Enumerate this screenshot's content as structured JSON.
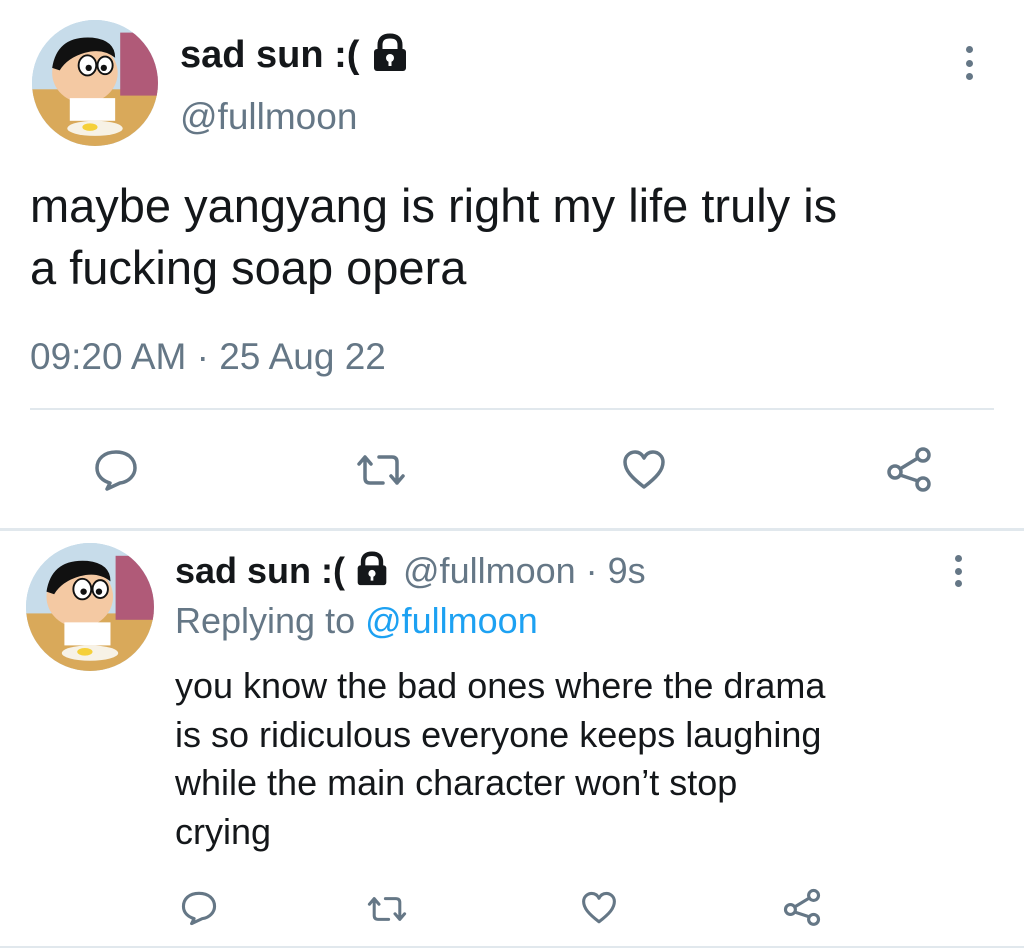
{
  "main_tweet": {
    "display_name": "sad sun :(",
    "handle": "@fullmoon",
    "text_line1": "maybe yangyang is right my life truly is",
    "text_line2": "a fucking soap opera",
    "timestamp": "09:20 AM · 25 Aug 22",
    "icons": {
      "lock": "lock-icon",
      "more": "more-vertical-icon",
      "reply": "reply-icon",
      "retweet": "retweet-icon",
      "like": "heart-icon",
      "share": "share-icon"
    }
  },
  "reply_tweet": {
    "display_name": "sad sun :(",
    "handle_time": "@fullmoon · 9s",
    "replying_to_prefix": "Replying to ",
    "replying_to_handle": "@fullmoon",
    "text_lines": [
      "you know the bad ones where the drama",
      "is so ridiculous everyone keeps laughing",
      "while the main character won’t stop",
      "crying"
    ]
  },
  "colors": {
    "text": "#14171a",
    "secondary": "#657786",
    "link": "#1da1f2",
    "divider": "#e1e8ed"
  }
}
